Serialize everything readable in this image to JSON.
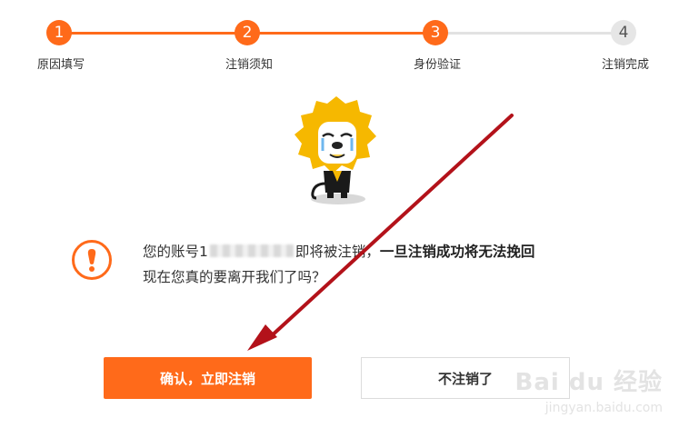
{
  "stepper": {
    "steps": [
      {
        "number": "1",
        "label": "原因填写",
        "state": "done"
      },
      {
        "number": "2",
        "label": "注销须知",
        "state": "done"
      },
      {
        "number": "3",
        "label": "身份验证",
        "state": "current"
      },
      {
        "number": "4",
        "label": "注销完成",
        "state": "todo"
      }
    ]
  },
  "message": {
    "prefix": "您的账号1",
    "middle": "即将被注销，",
    "emphasis": "一旦注销成功将无法挽回",
    "line2": "现在您真的要离开我们了吗？"
  },
  "buttons": {
    "confirm_label": "确认，立即注销",
    "cancel_label": "不注销了"
  },
  "watermark": {
    "logo_text": "Bai du 经验",
    "url": "jingyan.baidu.com"
  },
  "colors": {
    "accent": "#ff6a1a",
    "arrow": "#b3121a",
    "inactive": "#e6e6e6"
  }
}
